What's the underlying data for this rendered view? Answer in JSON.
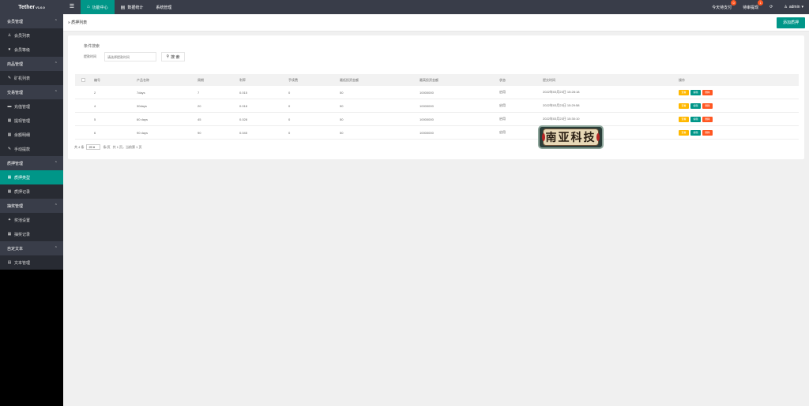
{
  "brand": {
    "name": "Tether",
    "version": "V1.0.0"
  },
  "top_tabs": [
    {
      "label": "功能中心",
      "icon": "home-icon"
    },
    {
      "label": "数据统计",
      "icon": "chart-icon"
    },
    {
      "label": "系统管理",
      "icon": ""
    }
  ],
  "top_right": {
    "item1": "今天待支付",
    "item1_badge": "0",
    "item2": "待审提现",
    "item2_badge": "1",
    "user": "admin"
  },
  "sidebar": {
    "g1": "会员管理",
    "g1_i1": "会员列表",
    "g1_i2": "会员等级",
    "g2": "商品管理",
    "g2_i1": "矿机列表",
    "g3": "交易管理",
    "g3_i1": "充值管理",
    "g3_i2": "提现管理",
    "g3_i3": "余额明细",
    "g3_i4": "手动提款",
    "g4": "质押管理",
    "g4_i1": "质押类型",
    "g4_i2": "质押记录",
    "g5": "抽奖管理",
    "g5_i1": "奖池设置",
    "g5_i2": "抽奖记录",
    "g6": "自定文本",
    "g6_i1": "文本管理"
  },
  "breadcrumb": "质押列表",
  "add_button": "添加质押",
  "search": {
    "title": "条件搜索",
    "label": "提款时间",
    "placeholder": "请选择提款时间",
    "button": "搜 索"
  },
  "table": {
    "headers": [
      "编号",
      "产品名称",
      "周期",
      "利率",
      "手续费",
      "最低投资金额",
      "最高投资金额",
      "状态",
      "提交时间",
      "操作"
    ],
    "rows": [
      {
        "id": "2",
        "name": "7days",
        "period": "7",
        "rate": "0.015",
        "fee": "0",
        "min": "50",
        "max": "10000000",
        "status": "启用",
        "time": "2022年03月23日 15:28:18"
      },
      {
        "id": "4",
        "name": "30days",
        "period": "20",
        "rate": "0.018",
        "fee": "0",
        "min": "50",
        "max": "10000000",
        "status": "启用",
        "time": "2022年03月23日 15:29:58"
      },
      {
        "id": "5",
        "name": "60 days",
        "period": "45",
        "rate": "0.028",
        "fee": "0",
        "min": "50",
        "max": "10000000",
        "status": "启用",
        "time": "2022年03月23日 15:30:10"
      },
      {
        "id": "6",
        "name": "90 days",
        "period": "90",
        "rate": "0.045",
        "fee": "0",
        "min": "50",
        "max": "10000000",
        "status": "启用",
        "time": ""
      }
    ],
    "ops": {
      "view": "查看",
      "edit": "编辑",
      "delete": "删除"
    }
  },
  "pager": {
    "total": "共 4 条",
    "page_size": "20",
    "per_page": "条/页",
    "info": "共 1 页，当前第 1 页"
  },
  "stamp_text": "南亚科技",
  "colors": {
    "accent": "#009688",
    "topbar": "#393d49",
    "warn": "#ffb800",
    "danger": "#ff5722"
  }
}
